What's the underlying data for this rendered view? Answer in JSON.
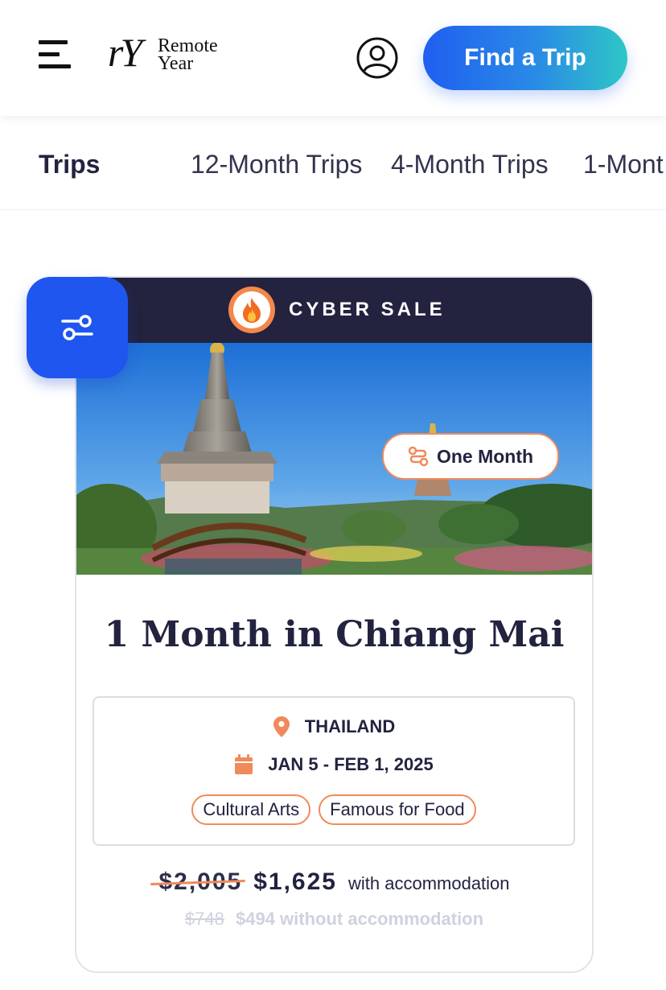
{
  "header": {
    "logo_mark": "rY",
    "logo_line1": "Remote",
    "logo_line2": "Year",
    "cta_label": "Find a Trip"
  },
  "trip_nav": {
    "title": "Trips",
    "tabs": [
      "12-Month Trips",
      "4-Month Trips",
      "1-Mont"
    ]
  },
  "card": {
    "sale_label": "CYBER SALE",
    "duration_badge": "One Month",
    "title": "1 Month in Chiang Mai",
    "country": "THAILAND",
    "dates": "JAN 5 - FEB 1, 2025",
    "tags": [
      "Cultural Arts",
      "Famous for Food"
    ],
    "price_old": "$2,005",
    "price_new": "$1,625",
    "price_note": "with accommodation",
    "alt_price_old": "$748",
    "alt_price_new": "$494 without accommodation"
  },
  "icons": {
    "menu": "hamburger-icon",
    "account": "user-circle-icon",
    "sale": "fire-icon",
    "duration": "route-icon",
    "location": "map-pin-icon",
    "calendar": "calendar-icon",
    "filter": "sliders-icon"
  },
  "colors": {
    "accent_orange": "#f08a5b",
    "navy": "#23223f",
    "filter_blue": "#1f56f0",
    "cta_start": "#1f5ff0",
    "cta_end": "#2ec7c6"
  }
}
